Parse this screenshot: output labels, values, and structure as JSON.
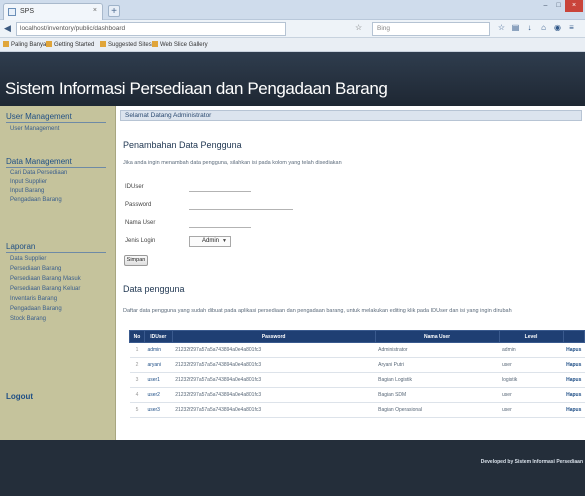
{
  "browser": {
    "tab_title": "SPS",
    "tab_close": "×",
    "new_tab": "+",
    "url": "localhost/inventory/public/dashboard",
    "search_placeholder": "Bing",
    "window_buttons": [
      "–",
      "□",
      "×"
    ],
    "bookmarks": [
      "Paling Banyak",
      "Getting Started",
      "Suggested Sites",
      "Web Slice Gallery"
    ]
  },
  "header": {
    "site_title": "Sistem Informasi Persediaan dan Pengadaan Barang"
  },
  "sidebar": {
    "sections": [
      {
        "title": "User Management",
        "items": [
          "User Management"
        ]
      },
      {
        "title": "Data Management",
        "items": [
          "Cari Data Persediaan",
          "Input Supplier",
          "Input Barang",
          "Pengadaan Barang"
        ]
      },
      {
        "title": "Laporan",
        "items": [
          "Data Supplier",
          "Persediaan Barang",
          "Persediaan Barang Masuk",
          "Persediaan Barang Keluar",
          "Inventaris Barang",
          "Pengadaan Barang",
          "Stock Barang"
        ]
      }
    ],
    "logout": "Logout"
  },
  "content": {
    "welcome": "Selamat Datang Administrator",
    "form_title": "Penambahan Data Pengguna",
    "form_desc": "Jika anda ingin menambah data pengguna, silahkan isi pada kolom yang telah disediakan",
    "fields": [
      {
        "label": "IDUser",
        "value": ""
      },
      {
        "label": "Password",
        "value": ""
      },
      {
        "label": "Nama User",
        "value": ""
      }
    ],
    "level_label": "Jenis Login",
    "level_value": "Admin",
    "submit": "Simpan",
    "table_title": "Data pengguna",
    "table_desc": "Daftar data pengguna yang sudah dibuat pada aplikasi persediaan dan pengadaan barang, untuk melakukan editing klik pada IDUser dan isi yang ingin dirubah",
    "columns": [
      "No",
      "IDUser",
      "Password",
      "Nama User",
      "Level",
      ""
    ],
    "rows": [
      {
        "no": "1",
        "user": "admin",
        "password": "21232f297a57a5a743894a0e4a801fc3",
        "name": "Administrator",
        "level": "admin",
        "action": "Hapus"
      },
      {
        "no": "2",
        "user": "aryani",
        "password": "21232f297a57a5a743894a0e4a801fc3",
        "name": "Aryani Putri",
        "level": "user",
        "action": "Hapus"
      },
      {
        "no": "3",
        "user": "user1",
        "password": "21232f297a57a5a743894a0e4a801fc3",
        "name": "Bagian Logistik",
        "level": "logistik",
        "action": "Hapus"
      },
      {
        "no": "4",
        "user": "user2",
        "password": "21232f297a57a5a743894a0e4a801fc3",
        "name": "Bagian SDM",
        "level": "user",
        "action": "Hapus"
      },
      {
        "no": "5",
        "user": "user3",
        "password": "21232f297a57a5a743894a0e4a801fc3",
        "name": "Bagian Operasional",
        "level": "user",
        "action": "Hapus"
      }
    ]
  },
  "footer": {
    "text": "Developed by Sistem Informasi Persediaan"
  }
}
